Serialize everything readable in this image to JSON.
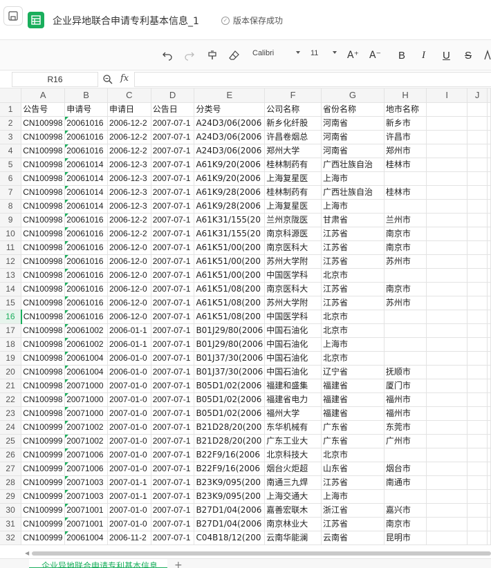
{
  "header": {
    "doc_title": "企业异地联合申请专利基本信息_1",
    "save_status": "版本保存成功"
  },
  "toolbar": {
    "font_name": "Calibri",
    "font_size": "11",
    "increase_font_label": "A⁺",
    "decrease_font_label": "A⁻",
    "bold_label": "B",
    "italic_label": "I",
    "underline_label": "U",
    "strike_label": "S"
  },
  "formula_bar": {
    "cell_ref": "R16",
    "fx_label": "fx",
    "value": ""
  },
  "active_row": 16,
  "accent_color": "#1aae5c",
  "grid": {
    "columns": [
      "A",
      "B",
      "C",
      "D",
      "E",
      "F",
      "G",
      "H",
      "I",
      "J"
    ],
    "rows": [
      [
        "公告号",
        "申请号",
        "申请日",
        "公告日",
        "分类号",
        "公司名称",
        "省份名称",
        "地市名称"
      ],
      [
        "CN100998",
        "20061016",
        "2006-12-2",
        "2007-07-1",
        "A24D3/06(2006",
        "新乡化纤股",
        "河南省",
        "新乡市"
      ],
      [
        "CN100998",
        "20061016",
        "2006-12-2",
        "2007-07-1",
        "A24D3/06(2006",
        "许昌卷烟总",
        "河南省",
        "许昌市"
      ],
      [
        "CN100998",
        "20061016",
        "2006-12-2",
        "2007-07-1",
        "A24D3/06(2006",
        "郑州大学",
        "河南省",
        "郑州市"
      ],
      [
        "CN100998",
        "20061014",
        "2006-12-3",
        "2007-07-1",
        "A61K9/20(2006",
        "桂林制药有",
        "广西壮族自治",
        "桂林市"
      ],
      [
        "CN100998",
        "20061014",
        "2006-12-3",
        "2007-07-1",
        "A61K9/20(2006",
        "上海复星医",
        "上海市",
        ""
      ],
      [
        "CN100998",
        "20061014",
        "2006-12-3",
        "2007-07-1",
        "A61K9/28(2006",
        "桂林制药有",
        "广西壮族自治",
        "桂林市"
      ],
      [
        "CN100998",
        "20061014",
        "2006-12-3",
        "2007-07-1",
        "A61K9/28(2006",
        "上海复星医",
        "上海市",
        ""
      ],
      [
        "CN100998",
        "20061016",
        "2006-12-2",
        "2007-07-1",
        "A61K31/155(20",
        "兰州京陇医",
        "甘肃省",
        "兰州市"
      ],
      [
        "CN100998",
        "20061016",
        "2006-12-2",
        "2007-07-1",
        "A61K31/155(20",
        "南京科源医",
        "江苏省",
        "南京市"
      ],
      [
        "CN100998",
        "20061016",
        "2006-12-0",
        "2007-07-1",
        "A61K51/00(200",
        "南京医科大",
        "江苏省",
        "南京市"
      ],
      [
        "CN100998",
        "20061016",
        "2006-12-0",
        "2007-07-1",
        "A61K51/00(200",
        "苏州大学附",
        "江苏省",
        "苏州市"
      ],
      [
        "CN100998",
        "20061016",
        "2006-12-0",
        "2007-07-1",
        "A61K51/00(200",
        "中国医学科",
        "北京市",
        ""
      ],
      [
        "CN100998",
        "20061016",
        "2006-12-0",
        "2007-07-1",
        "A61K51/08(200",
        "南京医科大",
        "江苏省",
        "南京市"
      ],
      [
        "CN100998",
        "20061016",
        "2006-12-0",
        "2007-07-1",
        "A61K51/08(200",
        "苏州大学附",
        "江苏省",
        "苏州市"
      ],
      [
        "CN100998",
        "20061016",
        "2006-12-0",
        "2007-07-1",
        "A61K51/08(200",
        "中国医学科",
        "北京市",
        ""
      ],
      [
        "CN100998",
        "20061002",
        "2006-01-1",
        "2007-07-1",
        "B01J29/80(2006",
        "中国石油化",
        "北京市",
        ""
      ],
      [
        "CN100998",
        "20061002",
        "2006-01-1",
        "2007-07-1",
        "B01J29/80(2006",
        "中国石油化",
        "上海市",
        ""
      ],
      [
        "CN100998",
        "20061004",
        "2006-01-0",
        "2007-07-1",
        "B01J37/30(2006",
        "中国石油化",
        "北京市",
        ""
      ],
      [
        "CN100998",
        "20061004",
        "2006-01-0",
        "2007-07-1",
        "B01J37/30(2006",
        "中国石油化",
        "辽宁省",
        "抚顺市"
      ],
      [
        "CN100998",
        "20071000",
        "2007-01-0",
        "2007-07-1",
        "B05D1/02(2006",
        "福建和盛集",
        "福建省",
        "厦门市"
      ],
      [
        "CN100998",
        "20071000",
        "2007-01-0",
        "2007-07-1",
        "B05D1/02(2006",
        "福建省电力",
        "福建省",
        "福州市"
      ],
      [
        "CN100998",
        "20071000",
        "2007-01-0",
        "2007-07-1",
        "B05D1/02(2006",
        "福州大学",
        "福建省",
        "福州市"
      ],
      [
        "CN100999",
        "20071002",
        "2007-01-0",
        "2007-07-1",
        "B21D28/20(200",
        "东华机械有",
        "广东省",
        "东莞市"
      ],
      [
        "CN100999",
        "20071002",
        "2007-01-0",
        "2007-07-1",
        "B21D28/20(200",
        "广东工业大",
        "广东省",
        "广州市"
      ],
      [
        "CN100999",
        "20071006",
        "2007-01-0",
        "2007-07-1",
        "B22F9/16(2006",
        "北京科技大",
        "北京市",
        ""
      ],
      [
        "CN100999",
        "20071006",
        "2007-01-0",
        "2007-07-1",
        "B22F9/16(2006",
        "烟台火炬超",
        "山东省",
        "烟台市"
      ],
      [
        "CN100999",
        "20071003",
        "2007-01-1",
        "2007-07-1",
        "B23K9/095(200",
        "南通三九焊",
        "江苏省",
        "南通市"
      ],
      [
        "CN100999",
        "20071003",
        "2007-01-1",
        "2007-07-1",
        "B23K9/095(200",
        "上海交通大",
        "上海市",
        ""
      ],
      [
        "CN100999",
        "20071001",
        "2007-01-0",
        "2007-07-1",
        "B27D1/04(2006",
        "嘉善宏联木",
        "浙江省",
        "嘉兴市"
      ],
      [
        "CN100999",
        "20071001",
        "2007-01-0",
        "2007-07-1",
        "B27D1/04(2006",
        "南京林业大",
        "江苏省",
        "南京市"
      ],
      [
        "CN100999",
        "20061004",
        "2006-11-2",
        "2007-07-1",
        "C04B18/12(200",
        "云南华能澜",
        "云南省",
        "昆明市"
      ]
    ]
  },
  "sheet_tab": "企业异地联合申请专利基本信息",
  "add_sheet_label": "+"
}
